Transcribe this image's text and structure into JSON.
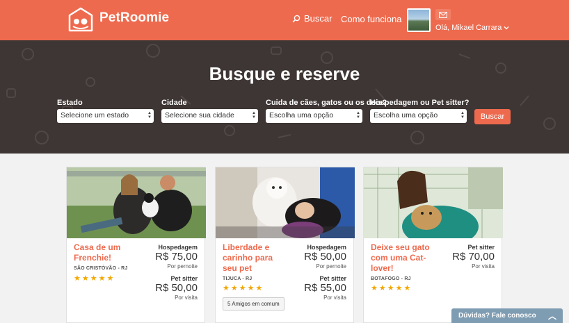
{
  "header": {
    "brand": "PetRoomie",
    "nav": {
      "search": "Buscar",
      "how_it_works": "Como funciona"
    },
    "user_greeting": "Olá, Mikael Carrara",
    "colors": {
      "primary": "#ee6a4e",
      "hero_bg": "#3e3634"
    }
  },
  "hero": {
    "title": "Busque e reserve",
    "fields": [
      {
        "label": "Estado",
        "value": "Selecione um estado"
      },
      {
        "label": "Cidade",
        "value": "Selecione sua cidade"
      },
      {
        "label": "Cuida de cães, gatos ou os dois?",
        "value": "Escolha uma opção"
      },
      {
        "label": "Hospedagem ou Pet sitter?",
        "value": "Escolha uma opção"
      }
    ],
    "search_button": "Buscar"
  },
  "cards": [
    {
      "title": "Casa de um Frenchie!",
      "location": "SÃO CRISTÓVÃO - RJ",
      "rating": 5,
      "services": [
        {
          "name": "Hospedagem",
          "price": "R$ 75,00",
          "unit": "Por pernoite"
        },
        {
          "name": "Pet sitter",
          "price": "R$ 50,00",
          "unit": "Por visita"
        }
      ]
    },
    {
      "title": "Liberdade e carinho para seu pet",
      "location": "TIJUCA - RJ",
      "rating": 5,
      "friends": "5 Amigos em comum",
      "services": [
        {
          "name": "Hospedagem",
          "price": "R$ 50,00",
          "unit": "Por pernoite"
        },
        {
          "name": "Pet sitter",
          "price": "R$ 55,00",
          "unit": "Por visita"
        }
      ]
    },
    {
      "title": "Deixe seu gato com uma Cat-lover!",
      "location": "BOTAFOGO - RJ",
      "rating": 5,
      "services": [
        {
          "name": "Pet sitter",
          "price": "R$ 70,00",
          "unit": "Por visita"
        }
      ]
    }
  ],
  "chat": {
    "label": "Dúvidas? Fale conosco"
  }
}
